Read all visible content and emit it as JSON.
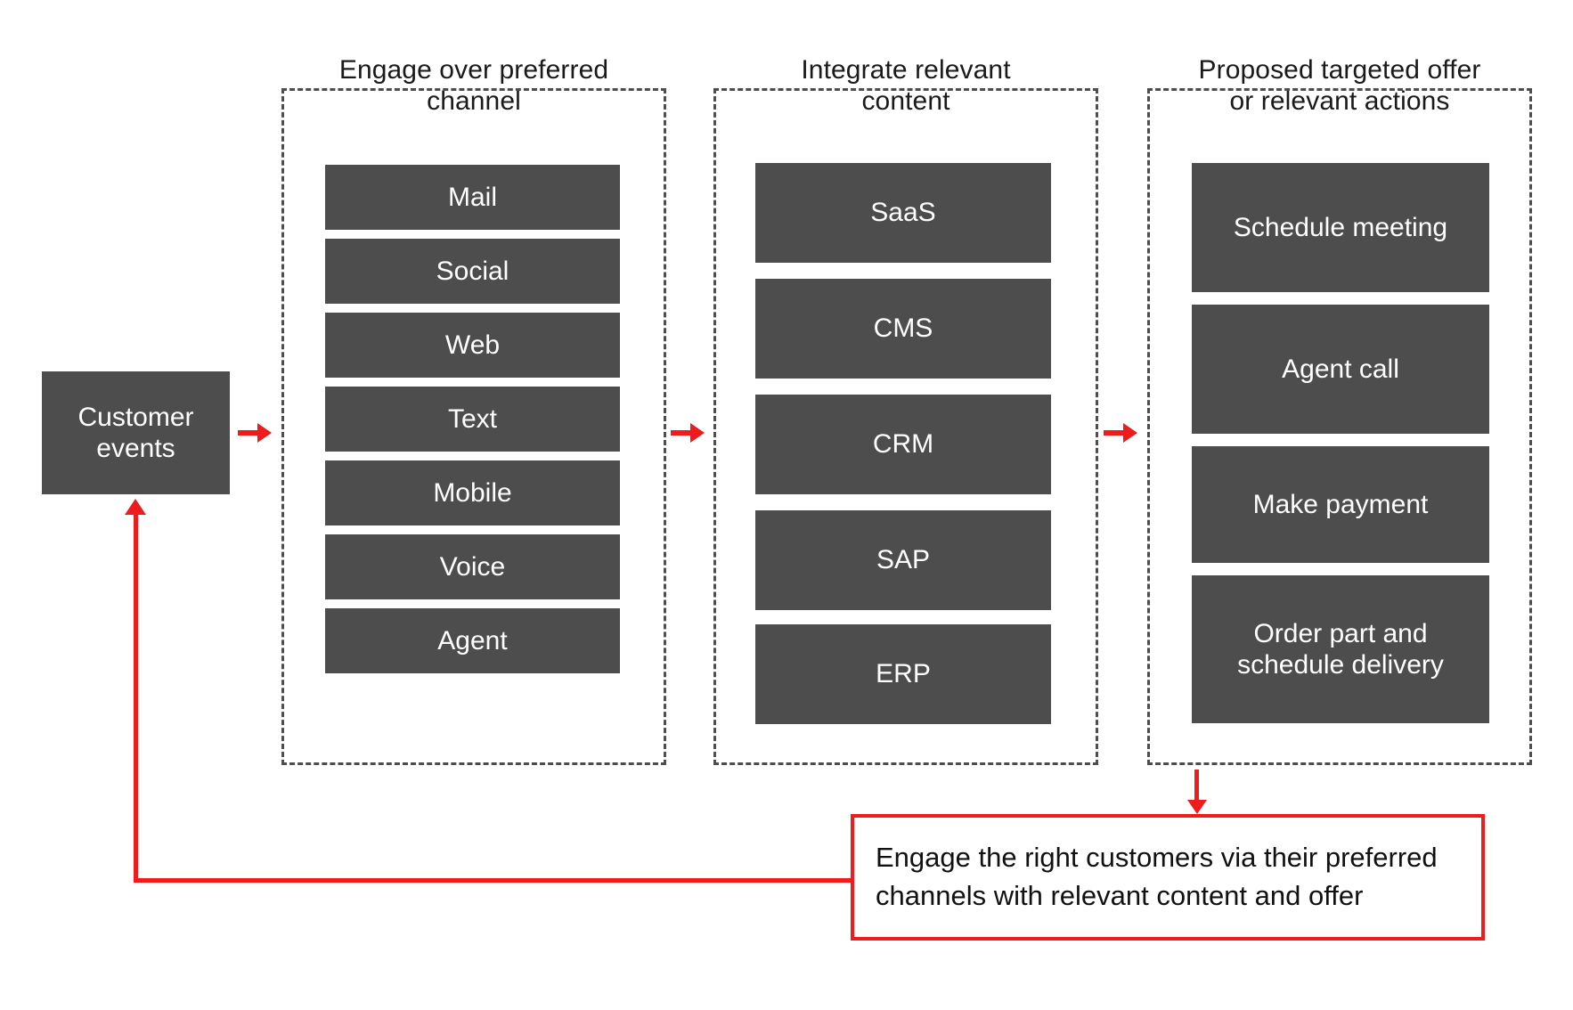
{
  "diagram": {
    "source_node": {
      "label": "Customer events",
      "lines": [
        "Customer",
        "events"
      ]
    },
    "stages": [
      {
        "title": "Engage over preferred channel",
        "title_lines": [
          "Engage over preferred",
          "channel"
        ],
        "items": [
          "Mail",
          "Social",
          "Web",
          "Text",
          "Mobile",
          "Voice",
          "Agent"
        ]
      },
      {
        "title": "Integrate relevant content",
        "title_lines": [
          "Integrate relevant",
          "content"
        ],
        "items": [
          "SaaS",
          "CMS",
          "CRM",
          "SAP",
          "ERP"
        ]
      },
      {
        "title": "Proposed targeted offer or relevant actions",
        "title_lines": [
          "Proposed targeted offer",
          "or relevant actions"
        ],
        "items": [
          "Schedule meeting",
          "Agent call",
          "Make payment",
          "Order part and schedule delivery"
        ],
        "item_lines": [
          [
            "Schedule meeting"
          ],
          [
            "Agent call"
          ],
          [
            "Make payment"
          ],
          [
            "Order part and",
            "schedule delivery"
          ]
        ]
      }
    ],
    "callout": {
      "text": "Engage the right customers via their preferred channels with relevant content and offer",
      "lines": [
        "Engage the right customers via their preferred",
        "channels with relevant content and offer"
      ]
    },
    "colors": {
      "block_fill": "#4d4d4d",
      "block_text": "#ffffff",
      "accent_red": "#ee1c1c",
      "dashed_border": "#4d4d4d",
      "background": "#ffffff",
      "title_text": "#1a1a1a"
    }
  }
}
